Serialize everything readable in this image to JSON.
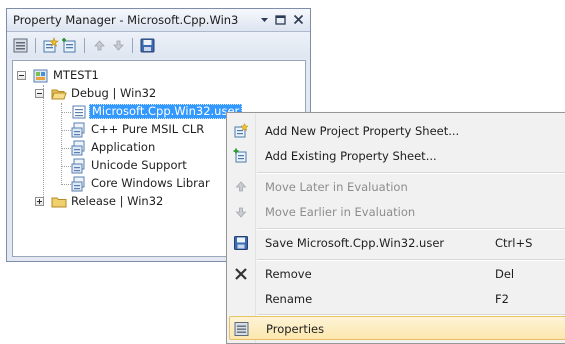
{
  "window": {
    "title": "Property Manager - Microsoft.Cpp.Win3...",
    "controls": [
      "dropdown-arrow-icon",
      "maximize-icon",
      "close-icon"
    ]
  },
  "toolbar": {
    "buttons": [
      "properties-icon",
      "add-new-sheet-icon",
      "add-existing-sheet-icon",
      "move-up-icon",
      "move-down-icon",
      "save-icon"
    ]
  },
  "tree": {
    "project": "MTEST1",
    "config_debug": "Debug | Win32",
    "sheets": [
      "Microsoft.Cpp.Win32.user",
      "C++ Pure MSIL CLR",
      "Application",
      "Unicode Support",
      "Core Windows Librar"
    ],
    "config_release": "Release | Win32"
  },
  "menu": {
    "items": [
      {
        "label": "Add New Project Property Sheet...",
        "shortcut": "",
        "icon": "add-new-sheet-icon",
        "enabled": true
      },
      {
        "label": "Add Existing Property Sheet...",
        "shortcut": "",
        "icon": "add-existing-sheet-icon",
        "enabled": true
      },
      {
        "label": "Move Later in Evaluation",
        "shortcut": "",
        "icon": "move-up-icon",
        "enabled": false
      },
      {
        "label": "Move Earlier in Evaluation",
        "shortcut": "",
        "icon": "move-down-icon",
        "enabled": false
      },
      {
        "label": "Save Microsoft.Cpp.Win32.user",
        "shortcut": "Ctrl+S",
        "icon": "save-icon",
        "enabled": true
      },
      {
        "label": "Remove",
        "shortcut": "Del",
        "icon": "remove-x-icon",
        "enabled": true
      },
      {
        "label": "Rename",
        "shortcut": "F2",
        "icon": "",
        "enabled": true
      },
      {
        "label": "Properties",
        "shortcut": "",
        "icon": "properties-icon",
        "enabled": true
      }
    ]
  },
  "colors": {
    "selection": "#3399ff",
    "menu_hover": "#fce7ad",
    "panel_bg": "#e3e8f2"
  }
}
